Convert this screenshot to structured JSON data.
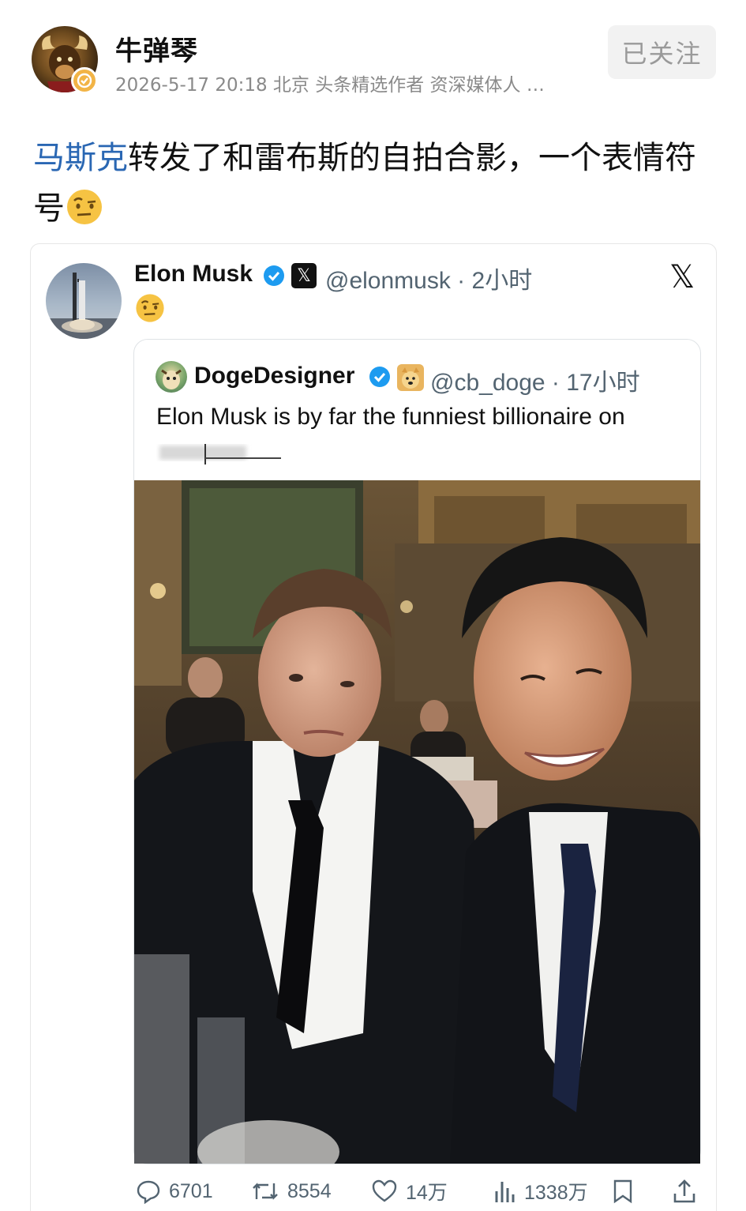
{
  "author": {
    "name": "牛弹琴",
    "meta": "2026-5-17 20:18 北京 头条精选作者 资深媒体人 …",
    "follow_label": "已关注"
  },
  "post": {
    "mention": "马斯克",
    "text": "转发了和雷布斯的自拍合影，一个表情符号"
  },
  "tweet": {
    "name": "Elon Musk",
    "x_badge": "𝕏",
    "handle_time": "@elonmusk · 2小时",
    "x_logo": "𝕏"
  },
  "quote": {
    "name": "DogeDesigner",
    "handle_time": "@cb_doge · 17小时",
    "text": "Elon Musk is by far the funniest billionaire on"
  },
  "actions": {
    "replies": "6701",
    "retweets": "8554",
    "likes": "14万",
    "views": "1338万"
  },
  "colors": {
    "mention": "#2a67b3",
    "verified_blue": "#1d9bf0",
    "follow_bg": "#f2f2f2"
  }
}
